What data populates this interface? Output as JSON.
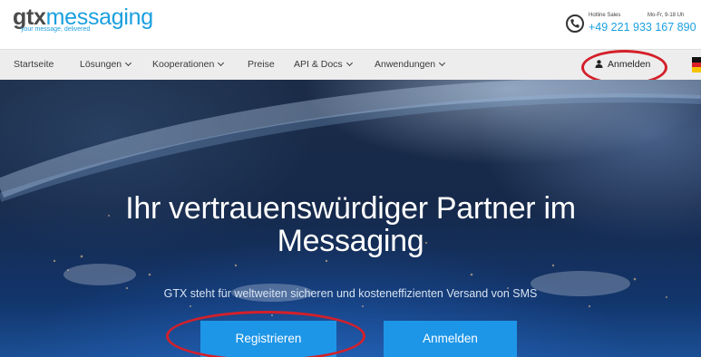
{
  "logo": {
    "brand_gtx": "gtx",
    "brand_messaging": "messaging",
    "tagline": "your message, delivered"
  },
  "hotline": {
    "icon": "phone-icon",
    "label": "Hotline Sales",
    "hours": "Mo-Fr, 9-18 Uh",
    "number": "+49 221 933 167 890"
  },
  "nav": {
    "items": [
      {
        "label": "Startseite",
        "dropdown": false
      },
      {
        "label": "Lösungen",
        "dropdown": true
      },
      {
        "label": "Kooperationen",
        "dropdown": true
      },
      {
        "label": "Preise",
        "dropdown": false
      },
      {
        "label": "API & Docs",
        "dropdown": true
      },
      {
        "label": "Anwendungen",
        "dropdown": true
      }
    ],
    "login_label": "Anmelden",
    "login_icon": "user-icon",
    "flag": "german-flag-icon"
  },
  "hero": {
    "title_line1": "Ihr vertrauenswürdiger Partner im",
    "title_line2": "Messaging",
    "subtitle": "GTX steht für weltweiten sicheren und kosteneffizienten Versand von SMS",
    "register_button": "Registrieren",
    "login_button": "Anmelden"
  },
  "colors": {
    "brand_blue": "#1a9fe0",
    "button_blue": "#1e96e8",
    "nav_bg": "#ededed",
    "annotation_red": "#d4202a"
  }
}
